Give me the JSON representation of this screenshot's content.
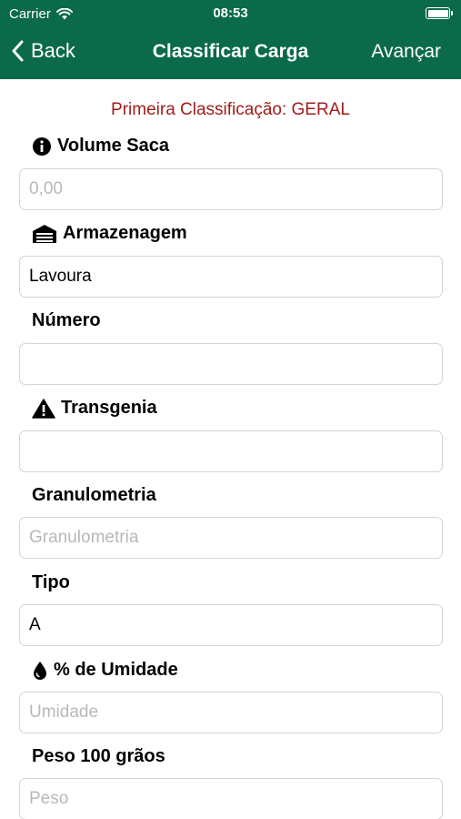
{
  "status_bar": {
    "carrier": "Carrier",
    "time": "08:53"
  },
  "nav": {
    "back_label": "Back",
    "title": "Classificar Carga",
    "next_label": "Avançar"
  },
  "subtitle": "Primeira Classificação: GERAL",
  "fields": [
    {
      "label": "Volume Saca",
      "icon": "info-icon",
      "value": "",
      "placeholder": "0,00"
    },
    {
      "label": "Armazenagem",
      "icon": "warehouse-icon",
      "value": "Lavoura",
      "placeholder": ""
    },
    {
      "label": "Número",
      "icon": "",
      "value": "",
      "placeholder": ""
    },
    {
      "label": "Transgenia",
      "icon": "warning-icon",
      "value": "",
      "placeholder": ""
    },
    {
      "label": "Granulometria",
      "icon": "",
      "value": "",
      "placeholder": "Granulometria"
    },
    {
      "label": "Tipo",
      "icon": "",
      "value": "A",
      "placeholder": ""
    },
    {
      "label": "% de Umidade",
      "icon": "droplet-icon",
      "value": "",
      "placeholder": "Umidade"
    },
    {
      "label": "Peso 100 grãos",
      "icon": "",
      "value": "",
      "placeholder": "Peso"
    }
  ]
}
